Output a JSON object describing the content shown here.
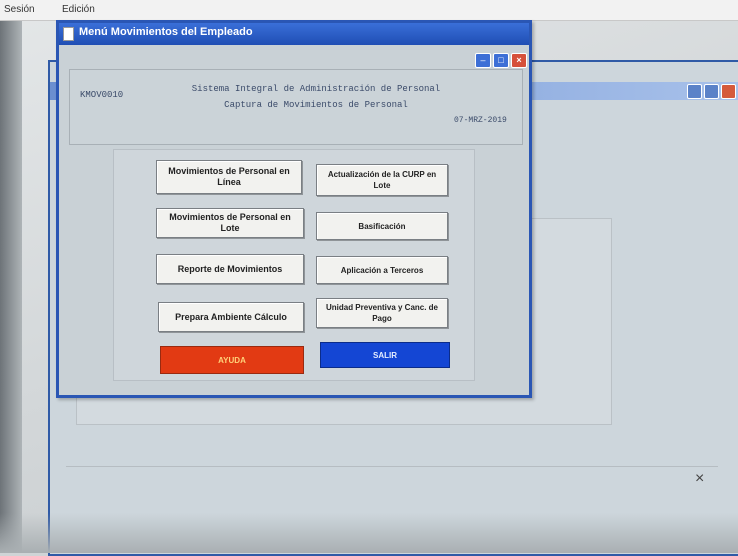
{
  "menubar": {
    "sesion": "Sesión",
    "edicion": "Edición"
  },
  "dialog": {
    "title": "Menú Movimientos del Empleado",
    "program_id": "KMOV0010",
    "system_title": "Sistema Integral de Administración de Personal",
    "system_subtitle": "Captura de Movimientos de Personal",
    "date": "07-MRZ-2019"
  },
  "buttons": {
    "mov_linea": "Movimientos de Personal en Línea",
    "curp_lote": "Actualización de la CURP en Lote",
    "mov_lote": "Movimientos de Personal en Lote",
    "basificacion": "Basificación",
    "reporte": "Reporte de Movimientos",
    "aplicacion": "Aplicación a Terceros",
    "prepara": "Prepara Ambiente Cálculo",
    "unidad": "Unidad Preventiva y Canc. de Pago",
    "ayuda": "AYUDA",
    "salir": "SALIR"
  },
  "background": {
    "close_mark": "×"
  },
  "colors": {
    "ayuda": "#e23a13",
    "salir": "#1446d4",
    "titlebar": "#2a56b4"
  }
}
